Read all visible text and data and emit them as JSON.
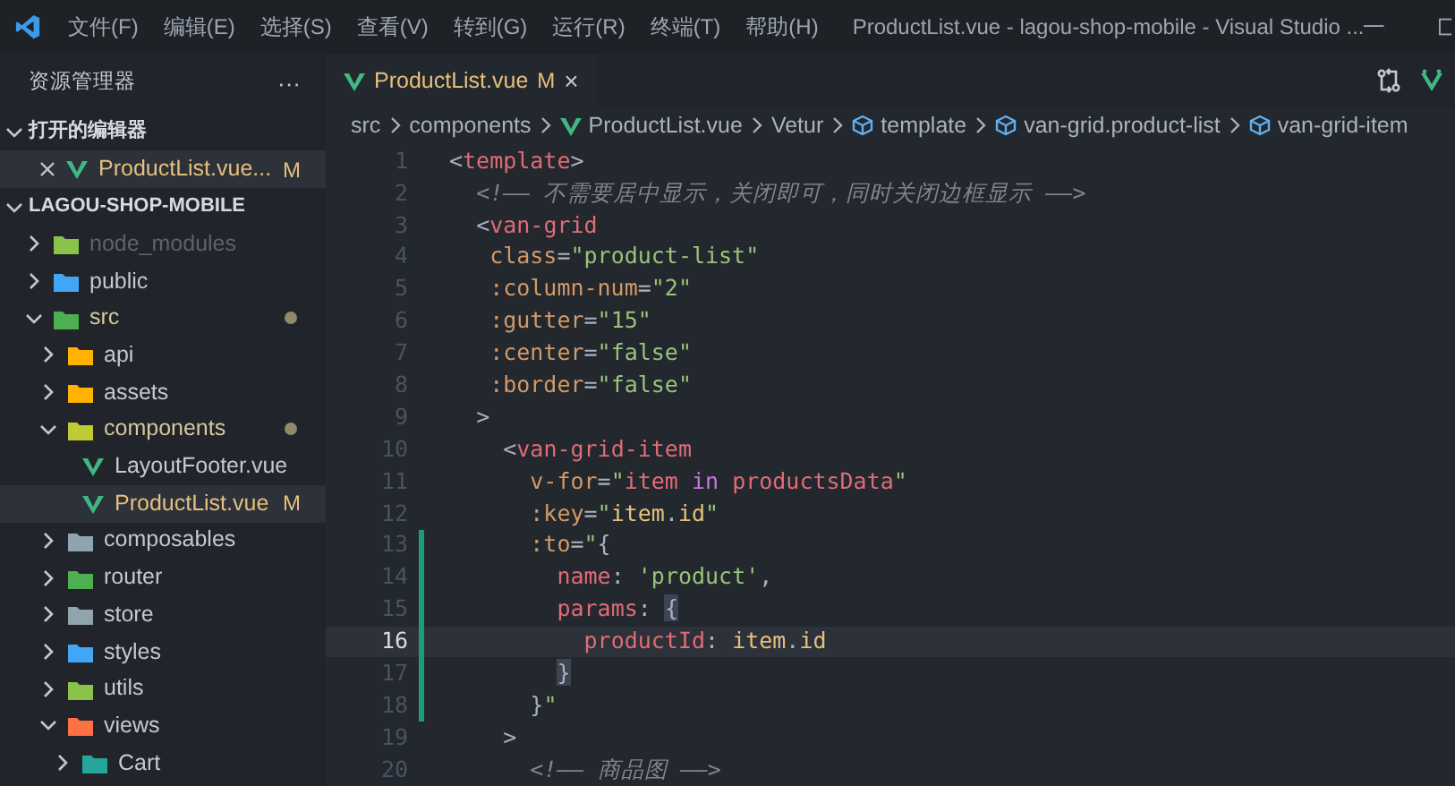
{
  "menu": [
    "文件(F)",
    "编辑(E)",
    "选择(S)",
    "查看(V)",
    "转到(G)",
    "运行(R)",
    "终端(T)",
    "帮助(H)"
  ],
  "window": {
    "title": "ProductList.vue - lagou-shop-mobile - Visual Studio ..."
  },
  "sidebar": {
    "title": "资源管理器",
    "more": "···",
    "open_editors": {
      "label": "打开的编辑器",
      "expanded": true,
      "items": [
        {
          "name": "ProductList.vue...",
          "badge": "M",
          "selected": true
        }
      ]
    },
    "project": {
      "label": "LAGOU-SHOP-MOBILE",
      "expanded": true,
      "items": [
        {
          "name": "node_modules",
          "kind": "folder",
          "expanded": false,
          "color": "#8bc34a",
          "ignored": true
        },
        {
          "name": "public",
          "kind": "folder",
          "expanded": false,
          "color": "#42a5f5"
        },
        {
          "name": "src",
          "kind": "folder",
          "expanded": true,
          "color": "#4caf50",
          "dot": true,
          "children": [
            {
              "name": "api",
              "kind": "folder",
              "expanded": false,
              "color": "#ffb300"
            },
            {
              "name": "assets",
              "kind": "folder",
              "expanded": false,
              "color": "#ffb300"
            },
            {
              "name": "components",
              "kind": "folder",
              "expanded": true,
              "color": "#c0ca33",
              "dot": true,
              "children": [
                {
                  "name": "LayoutFooter.vue",
                  "kind": "vue",
                  "selected": false
                },
                {
                  "name": "ProductList.vue",
                  "kind": "vue",
                  "badge": "M",
                  "selected": true
                }
              ]
            },
            {
              "name": "composables",
              "kind": "folder",
              "expanded": false,
              "color": "#90a4ae"
            },
            {
              "name": "router",
              "kind": "folder",
              "expanded": false,
              "color": "#4caf50"
            },
            {
              "name": "store",
              "kind": "folder",
              "expanded": false,
              "color": "#90a4ae"
            },
            {
              "name": "styles",
              "kind": "folder",
              "expanded": false,
              "color": "#42a5f5"
            },
            {
              "name": "utils",
              "kind": "folder",
              "expanded": false,
              "color": "#8bc34a"
            },
            {
              "name": "views",
              "kind": "folder",
              "expanded": true,
              "color": "#ff7043",
              "children": [
                {
                  "name": "Cart",
                  "kind": "folder",
                  "expanded": false,
                  "color": "#26a69a"
                }
              ]
            }
          ]
        }
      ]
    }
  },
  "tabs": [
    {
      "label": "ProductList.vue",
      "badge": "M",
      "close": "×",
      "selected": true
    }
  ],
  "breadcrumb": [
    {
      "label": "src",
      "kind": "text"
    },
    {
      "label": "components",
      "kind": "text"
    },
    {
      "label": "ProductList.vue",
      "kind": "vue"
    },
    {
      "label": "Vetur",
      "kind": "text"
    },
    {
      "label": "template",
      "kind": "symbol"
    },
    {
      "label": "van-grid.product-list",
      "kind": "symbol"
    },
    {
      "label": "van-grid-item",
      "kind": "symbol"
    }
  ],
  "code": [
    {
      "number": "1",
      "tokens": [
        {
          "text": "<",
          "kind": "punct"
        },
        {
          "text": "template",
          "kind": "tag"
        },
        {
          "text": ">",
          "kind": "punct"
        }
      ]
    },
    {
      "number": "2",
      "tokens": [
        {
          "text": "  <!—— 不需要居中显示，关闭即可，同时关闭边框显示 ——>",
          "kind": "comment"
        }
      ]
    },
    {
      "number": "3",
      "tokens": [
        {
          "text": "  <",
          "kind": "punct"
        },
        {
          "text": "van-grid",
          "kind": "tag"
        }
      ]
    },
    {
      "number": "4",
      "tokens": [
        {
          "text": "   class",
          "kind": "attr"
        },
        {
          "text": "=",
          "kind": "punct"
        },
        {
          "text": "\"product-list\"",
          "kind": "string"
        }
      ]
    },
    {
      "number": "5",
      "tokens": [
        {
          "text": "   :column-num",
          "kind": "attr"
        },
        {
          "text": "=",
          "kind": "punct"
        },
        {
          "text": "\"2\"",
          "kind": "string"
        }
      ]
    },
    {
      "number": "6",
      "tokens": [
        {
          "text": "   :gutter",
          "kind": "attr"
        },
        {
          "text": "=",
          "kind": "punct"
        },
        {
          "text": "\"15\"",
          "kind": "string"
        }
      ]
    },
    {
      "number": "7",
      "tokens": [
        {
          "text": "   :center",
          "kind": "attr"
        },
        {
          "text": "=",
          "kind": "punct"
        },
        {
          "text": "\"false\"",
          "kind": "string"
        }
      ]
    },
    {
      "number": "8",
      "tokens": [
        {
          "text": "   :border",
          "kind": "attr"
        },
        {
          "text": "=",
          "kind": "punct"
        },
        {
          "text": "\"false\"",
          "kind": "string"
        }
      ]
    },
    {
      "number": "9",
      "tokens": [
        {
          "text": "  >",
          "kind": "punct"
        }
      ]
    },
    {
      "number": "10",
      "tokens": [
        {
          "text": "    <",
          "kind": "punct"
        },
        {
          "text": "van-grid-item",
          "kind": "tag"
        }
      ]
    },
    {
      "number": "11",
      "tokens": [
        {
          "text": "      v-for",
          "kind": "attr"
        },
        {
          "text": "=",
          "kind": "punct"
        },
        {
          "text": "\"",
          "kind": "string"
        },
        {
          "text": "item",
          "kind": "key"
        },
        {
          "text": " in ",
          "kind": "keyword"
        },
        {
          "text": "productsData",
          "kind": "key"
        },
        {
          "text": "\"",
          "kind": "string"
        }
      ]
    },
    {
      "number": "12",
      "tokens": [
        {
          "text": "      :key",
          "kind": "attr"
        },
        {
          "text": "=",
          "kind": "punct"
        },
        {
          "text": "\"",
          "kind": "string"
        },
        {
          "text": "item",
          "kind": "var"
        },
        {
          "text": ".",
          "kind": "punct"
        },
        {
          "text": "id",
          "kind": "var"
        },
        {
          "text": "\"",
          "kind": "string"
        }
      ]
    },
    {
      "number": "13",
      "modified": true,
      "tokens": [
        {
          "text": "      :to",
          "kind": "attr"
        },
        {
          "text": "=",
          "kind": "punct"
        },
        {
          "text": "\"",
          "kind": "string"
        },
        {
          "text": "{",
          "kind": "punct"
        }
      ]
    },
    {
      "number": "14",
      "modified": true,
      "tokens": [
        {
          "text": "        name",
          "kind": "key"
        },
        {
          "text": ": ",
          "kind": "punct"
        },
        {
          "text": "'product'",
          "kind": "string"
        },
        {
          "text": ",",
          "kind": "punct"
        }
      ]
    },
    {
      "number": "15",
      "modified": true,
      "tokens": [
        {
          "text": "        params",
          "kind": "key"
        },
        {
          "text": ": ",
          "kind": "punct"
        },
        {
          "text": "{",
          "kind": "bracket"
        }
      ]
    },
    {
      "number": "16",
      "modified": true,
      "current": true,
      "tokens": [
        {
          "text": "          productId",
          "kind": "key"
        },
        {
          "text": ": ",
          "kind": "punct"
        },
        {
          "text": "item",
          "kind": "var"
        },
        {
          "text": ".",
          "kind": "punct"
        },
        {
          "text": "id",
          "kind": "var"
        }
      ]
    },
    {
      "number": "17",
      "modified": true,
      "tokens": [
        {
          "text": "        }",
          "kind": "bracket"
        }
      ]
    },
    {
      "number": "18",
      "modified": true,
      "tokens": [
        {
          "text": "      }",
          "kind": "punct"
        },
        {
          "text": "\"",
          "kind": "string"
        }
      ]
    },
    {
      "number": "19",
      "tokens": [
        {
          "text": "    >",
          "kind": "punct"
        }
      ]
    },
    {
      "number": "20",
      "tokens": [
        {
          "text": "      <!—— 商品图 ——>",
          "kind": "comment"
        }
      ]
    }
  ]
}
